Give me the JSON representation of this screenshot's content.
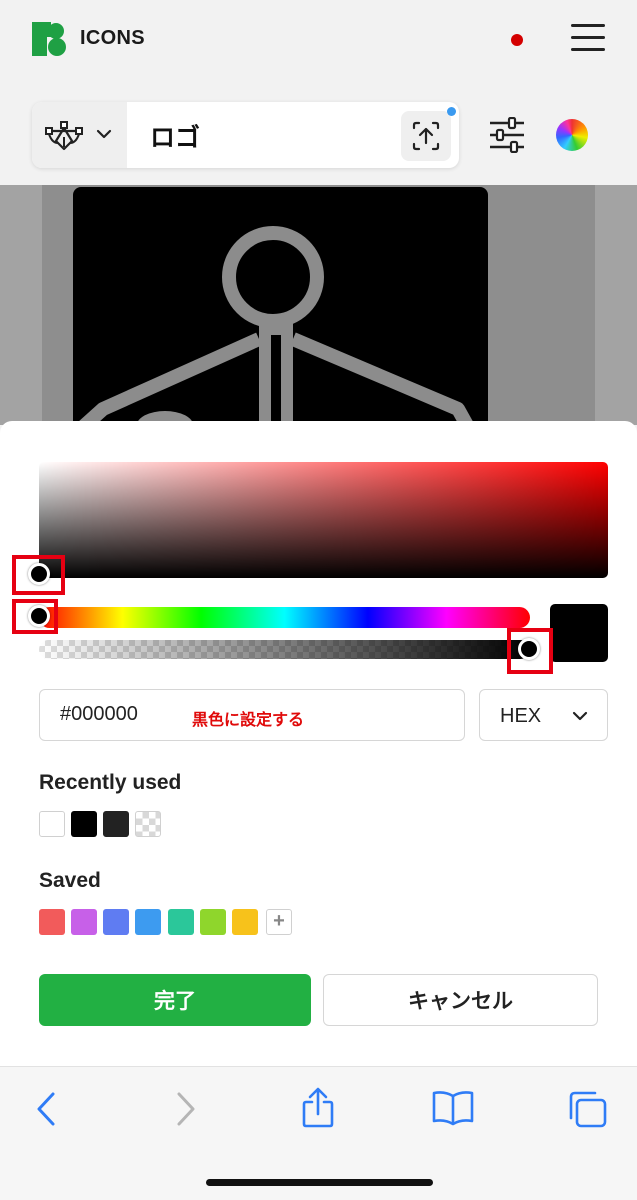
{
  "header": {
    "brand": "ICONS",
    "accent_color": "#1fa044",
    "notification_color": "#d40000"
  },
  "toolbar": {
    "search_value": "ロゴ",
    "type_icon": "pen-tool-icon",
    "upload_icon": "upload-icon",
    "filter_icon": "sliders-icon",
    "color_icon": "color-wheel-icon"
  },
  "color_picker": {
    "selected_color": "#000000",
    "hue": 0,
    "saturation": 0,
    "brightness": 0,
    "alpha": 1.0,
    "hex_value": "#000000",
    "annotation": "黒色に設定する",
    "format": "HEX",
    "recently_used_title": "Recently used",
    "recently_used": [
      "#ffffff",
      "#000000",
      "#222222",
      "transparent"
    ],
    "saved_title": "Saved",
    "saved": [
      "#f25b5b",
      "#c760e8",
      "#5f7cf2",
      "#3d9bf0",
      "#2bc79a",
      "#8fd62c",
      "#f7c21b"
    ],
    "add_label": "+",
    "done_label": "完了",
    "cancel_label": "キャンセル"
  },
  "browser_bar": {
    "back_icon": "back-arrow-icon",
    "forward_icon": "forward-arrow-icon",
    "share_icon": "share-icon",
    "bookmarks_icon": "bookmarks-icon",
    "tabs_icon": "tabs-icon",
    "icon_color": "#2f7cf6"
  }
}
